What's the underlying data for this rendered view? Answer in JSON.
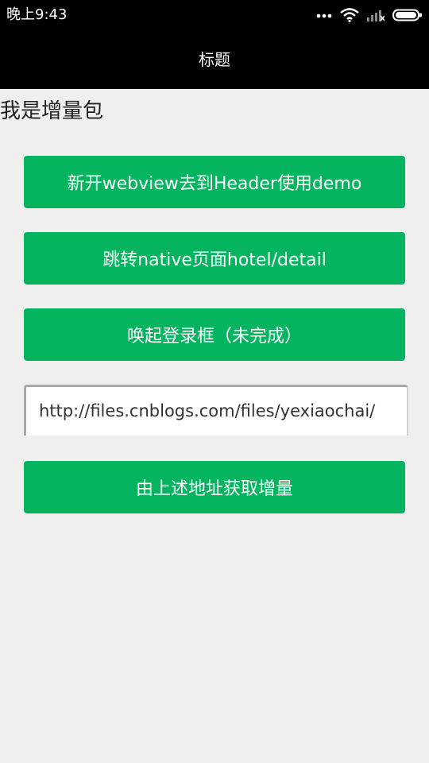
{
  "status_bar": {
    "time": "晚上9:43",
    "icons": [
      "more-dots-icon",
      "wifi-icon",
      "signal-icon",
      "battery-icon"
    ]
  },
  "title_bar": {
    "title": "标题"
  },
  "main": {
    "heading": "我是增量包",
    "buttons": [
      "新开webview去到Header使用demo",
      "跳转native页面hotel/detail",
      "唤起登录框（未完成）",
      "由上述地址获取增量"
    ],
    "url_input": {
      "value": "http://files.cnblogs.com/files/yexiaochai/"
    }
  },
  "colors": {
    "accent": "#04b45f",
    "bar_background": "#000000",
    "page_background": "#efefef"
  }
}
